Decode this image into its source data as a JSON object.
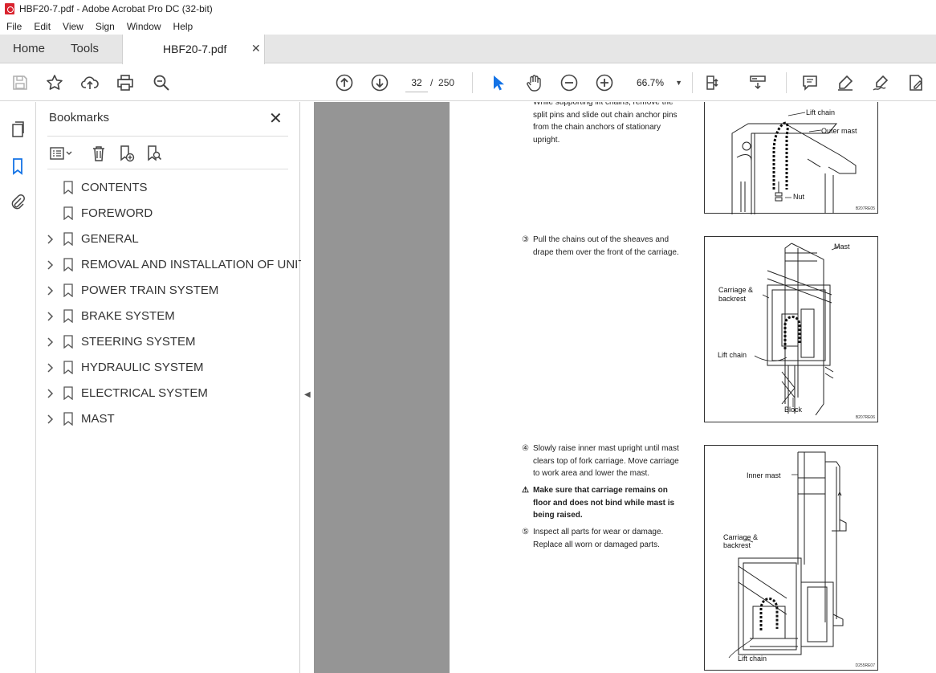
{
  "window": {
    "title": "HBF20-7.pdf - Adobe Acrobat Pro DC (32-bit)"
  },
  "menu": [
    "File",
    "Edit",
    "View",
    "Sign",
    "Window",
    "Help"
  ],
  "tabs": {
    "home": "Home",
    "tools": "Tools",
    "document": "HBF20-7.pdf"
  },
  "toolbar": {
    "current_page": "32",
    "page_separator": "/",
    "total_pages": "250",
    "zoom": "66.7%"
  },
  "bookmarks": {
    "title": "Bookmarks",
    "items": [
      {
        "label": "CONTENTS",
        "expandable": false
      },
      {
        "label": "FOREWORD",
        "expandable": false
      },
      {
        "label": "GENERAL",
        "expandable": true
      },
      {
        "label": "REMOVAL AND INSTALLATION OF UNIT",
        "expandable": true
      },
      {
        "label": "POWER TRAIN SYSTEM",
        "expandable": true
      },
      {
        "label": "BRAKE SYSTEM",
        "expandable": true
      },
      {
        "label": "STEERING SYSTEM",
        "expandable": true
      },
      {
        "label": "HYDRAULIC SYSTEM",
        "expandable": true
      },
      {
        "label": "ELECTRICAL SYSTEM",
        "expandable": true
      },
      {
        "label": "MAST",
        "expandable": true
      }
    ]
  },
  "document": {
    "step2": {
      "lines": [
        "While supporting lift chains, remove the",
        "split pins and slide out chain anchor pins",
        "from the chain anchors of stationary",
        "upright."
      ]
    },
    "step3": {
      "num": "③",
      "lines": [
        "Pull the chains out of the sheaves and",
        "drape them over the front of the carriage."
      ]
    },
    "step4": {
      "num": "④",
      "lines": [
        "Slowly raise inner mast upright until mast",
        "clears top of fork carriage.  Move carriage",
        "to work area and lower the mast."
      ]
    },
    "warning": {
      "symbol": "⚠",
      "lines": [
        "Make sure that carriage remains on",
        "floor and does not bind while mast is",
        "being raised."
      ]
    },
    "step5": {
      "num": "⑤",
      "lines": [
        "Inspect all parts for wear or damage.",
        "Replace all worn or damaged parts."
      ]
    },
    "fig1": {
      "labels": {
        "lift_chain": "Lift chain",
        "outer_mast": "Outer mast",
        "nut": "Nut"
      },
      "code": "B207RE05"
    },
    "fig2": {
      "labels": {
        "mast": "Mast",
        "carriage": "Carriage &",
        "backrest": "backrest",
        "lift_chain": "Lift chain",
        "block": "Block"
      },
      "code": "B207RE06"
    },
    "fig3": {
      "labels": {
        "inner_mast": "Inner mast",
        "carriage": "Carriage &",
        "backrest": "backrest",
        "lift_chain": "Lift chain"
      },
      "code": "D255RE07"
    }
  },
  "icons": {
    "save": "save-icon",
    "star": "star-icon",
    "upload": "upload-icon",
    "print": "print-icon",
    "zoom_search": "magnify-icon",
    "prev": "prev-page-icon",
    "next": "next-page-icon",
    "select": "pointer-icon",
    "hand": "hand-icon",
    "zoom_out": "zoom-out-icon",
    "zoom_in": "zoom-in-icon",
    "fit": "fit-page-icon",
    "scroll": "scroll-mode-icon",
    "comment": "comment-icon",
    "highlight": "highlight-icon",
    "sign": "sign-icon",
    "edit": "edit-pdf-icon"
  },
  "colors": {
    "accent": "#1473e6",
    "pdf_red": "#d9232e",
    "doc_bg": "#959595"
  }
}
